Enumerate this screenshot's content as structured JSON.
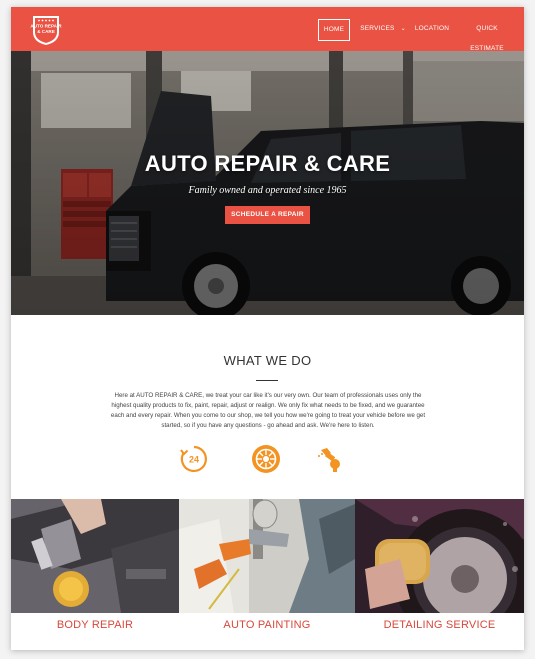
{
  "brand": {
    "logo_line1": "AUTO REPAIR",
    "logo_line2": "& CARE"
  },
  "nav": {
    "home": "HOME",
    "services": "SERVICES",
    "location": "LOCATION",
    "quick_estimate": "QUICK ESTIMATE"
  },
  "hero": {
    "title": "AUTO REPAIR & CARE",
    "subtitle": "Family owned and operated since 1965",
    "button": "SCHEDULE A REPAIR"
  },
  "what_we_do": {
    "title": "WHAT WE DO",
    "text": "Here at AUTO REPAIR & CARE, we treat your car like it's our very own. Our team of professionals uses only the highest quality products to fix, paint, repair, adjust or realign. We only fix what needs to be fixed, and we guarantee each and every repair. When you come to our shop, we tell you how we're going to treat your vehicle before we get started, so if you have any questions - go ahead and ask. We're here to listen.",
    "icons": [
      "24-hour-icon",
      "tire-icon",
      "spray-gun-icon"
    ],
    "icon_24_label": "24"
  },
  "services": [
    {
      "label": "BODY REPAIR",
      "image": "engine-repair-photo"
    },
    {
      "label": "AUTO PAINTING",
      "image": "spray-painting-photo"
    },
    {
      "label": "DETAILING SERVICE",
      "image": "tire-washing-photo"
    }
  ],
  "colors": {
    "accent": "#ea5343",
    "accent_text": "#d9473a",
    "icon_orange": "#f39322"
  }
}
